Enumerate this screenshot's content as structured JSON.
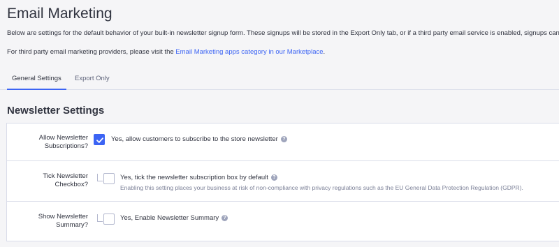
{
  "page": {
    "title": "Email Marketing",
    "intro": "Below are settings for the default behavior of your built-in newsletter signup form. These signups will be stored in the Export Only tab, or if a third party email service is enabled, signups can",
    "marketplace_prefix": "For third party email marketing providers, please visit the ",
    "marketplace_link": "Email Marketing apps category in our Marketplace",
    "marketplace_suffix": "."
  },
  "tabs": [
    {
      "label": "General Settings",
      "active": true
    },
    {
      "label": "Export Only",
      "active": false
    }
  ],
  "section": {
    "title": "Newsletter Settings",
    "rows": [
      {
        "label": "Allow Newsletter Subscriptions?",
        "checked": true,
        "option": "Yes, allow customers to subscribe to the store newsletter",
        "hint": ""
      },
      {
        "label": "Tick Newsletter Checkbox?",
        "checked": false,
        "option": "Yes, tick the newsletter subscription box by default",
        "hint": "Enabling this setting places your business at risk of non-compliance with privacy regulations such as the EU General Data Protection Regulation (GDPR)."
      },
      {
        "label": "Show Newsletter Summary?",
        "checked": false,
        "option": "Yes, Enable Newsletter Summary",
        "hint": ""
      }
    ]
  },
  "icons": {
    "help": "question-circle",
    "check": "checkmark"
  },
  "colors": {
    "accent": "#3c64f4",
    "text": "#313440",
    "muted": "#7a7f96",
    "background": "#f5f5f7",
    "border": "#d9dce9"
  }
}
